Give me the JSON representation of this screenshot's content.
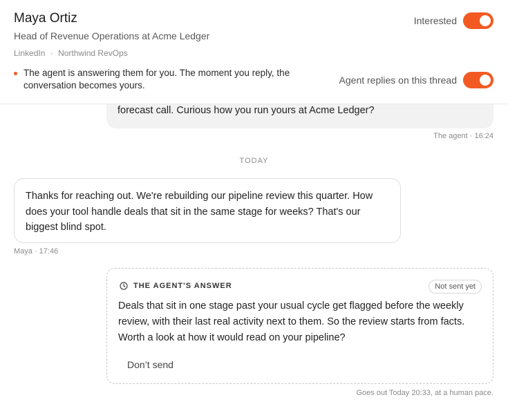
{
  "contact": {
    "name": "Maya Ortiz",
    "role": "Head of Revenue Operations at Acme Ledger",
    "source": "LinkedIn",
    "separator": "·",
    "workspace": "Northwind RevOps"
  },
  "toggles": {
    "interested": {
      "label": "Interested",
      "on": true
    },
    "agent_replies": {
      "label": "Agent replies on this thread",
      "on": true
    }
  },
  "notice": "The agent is answering them for you. The moment you reply, the conversation becomes yours.",
  "messages": [
    {
      "text": "forecast call. Curious how you run yours at Acme Ledger?",
      "meta": "The agent · 16:24"
    },
    {
      "text": "Thanks for reaching out. We're rebuilding our pipeline review this quarter. How does your tool handle deals that sit in the same stage for weeks? That's our biggest blind spot.",
      "meta": "Maya · 17:46"
    }
  ],
  "day_divider": "TODAY",
  "draft": {
    "title": "THE AGENT'S ANSWER",
    "status": "Not sent yet",
    "body": "Deals that sit in one stage past your usual cycle get flagged before the weekly review, with their last real activity next to them. So the review starts from facts. Worth a look at how it would read on your pipeline?",
    "dont_send_label": "Don’t send",
    "footnote": "Goes out Today 20:33, at a human pace."
  },
  "colors": {
    "accent": "#f25a22"
  }
}
